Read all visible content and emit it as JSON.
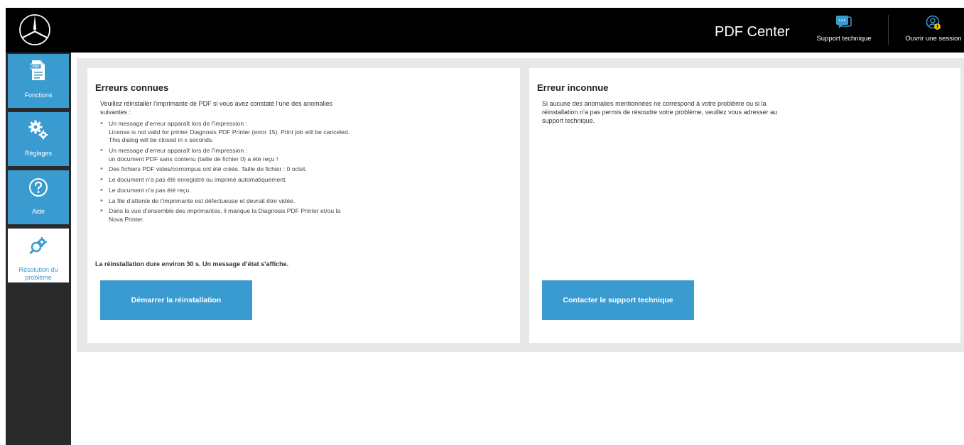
{
  "header": {
    "app_title": "PDF Center",
    "support_label": "Support technique",
    "login_label": "Ouvrir une session"
  },
  "sidebar": {
    "items": [
      {
        "label": "Fonctions",
        "icon": "pdf-document-icon"
      },
      {
        "label": "Réglages",
        "icon": "gears-icon"
      },
      {
        "label": "Aide",
        "icon": "question-icon"
      },
      {
        "label": "Résolution du problème",
        "icon": "magnifier-gear-icon",
        "active": true
      }
    ]
  },
  "known_errors": {
    "title": "Erreurs connues",
    "intro": "Veuillez réinstaller l’imprimante de PDF si vous avez constaté l’une des anomalies suivantes :",
    "items": [
      [
        "Un message d’erreur apparaît lors de l’impression :",
        "License is not valid for printer Diagnosis PDF Printer (error 15). Print job will be canceled.",
        "This dialog will be closed in x seconds."
      ],
      [
        "Un message d’erreur apparaît lors de l’impression :",
        "un document PDF sans contenu (taille de fichier 0) a été reçu !"
      ],
      [
        "Des fichiers PDF vides/corrompus ont été créés. Taille de fichier : 0 octet."
      ],
      [
        "Le document n’a pas été enregistré ou imprimé automatiquement."
      ],
      [
        "Le document n’a pas été reçu."
      ],
      [
        "La file d’attente de l’imprimante est défectueuse et devrait être vidée."
      ],
      [
        "Dans la vue d’ensemble des imprimantes, il manque la Diagnosis PDF Printer et/ou la Nova Printer."
      ]
    ],
    "duration_note": "La réinstallation dure environ 30 s. Un message d’état s’affiche.",
    "button_label": "Démarrer la réinstallation"
  },
  "unknown_error": {
    "title": "Erreur inconnue",
    "text": "Si aucune des anomalies mentionnées ne correspond à votre problème ou si la réinstallation n’a pas permis de résoudre votre problème, veuillez vous adresser au support technique.",
    "button_label": "Contacter le support technique"
  },
  "colors": {
    "accent": "#3a9bd0",
    "topbar": "#000000",
    "sidebar": "#2a2a2a",
    "content_bg": "#e8e8e8"
  }
}
